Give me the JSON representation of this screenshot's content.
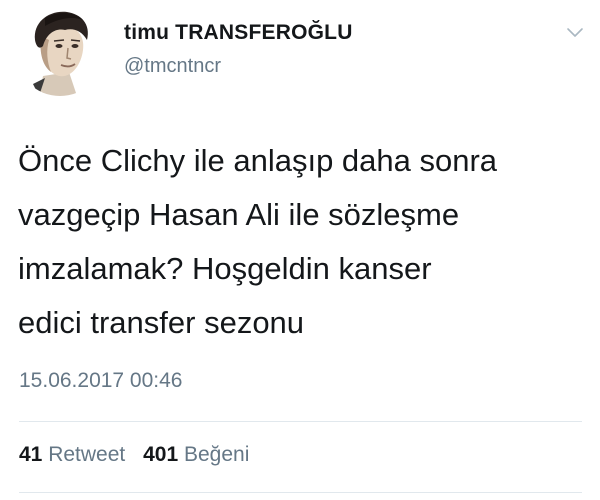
{
  "tweet": {
    "user": {
      "display_name": "timu TRANSFEROĞLU",
      "handle": "@tmcntncr",
      "avatar_icon": "user-avatar-sketch"
    },
    "menu_icon": "chevron-down-icon",
    "text_lines": [
      "Önce Clichy ile anlaşıp daha sonra",
      "vazgeçip Hasan Ali ile sözleşme",
      "imzalamak? Hoşgeldin kanser",
      "edici transfer sezonu"
    ],
    "timestamp": "15.06.2017 00:46",
    "stats": {
      "retweets": {
        "count": "41",
        "label": "Retweet"
      },
      "likes": {
        "count": "401",
        "label": "Beğeni"
      }
    }
  },
  "colors": {
    "text": "#14171a",
    "secondary": "#657786",
    "divider": "#e1e8ed"
  }
}
